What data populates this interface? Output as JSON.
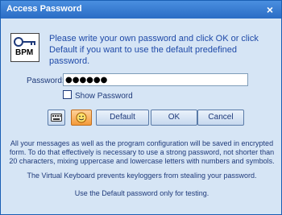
{
  "window": {
    "title": "Access Password",
    "close_glyph": "×"
  },
  "icon": {
    "name": "bpm-key-icon",
    "label": "BPM"
  },
  "intro": "Please write your own password and click OK or click Default if you want to use the default predefined password.",
  "password": {
    "label": "Password:",
    "value": "●●●●●●"
  },
  "show_password": {
    "label": "Show Password",
    "checked": false
  },
  "buttons": {
    "keyboard_icon": "keyboard-icon",
    "smile_icon": "smiley-icon",
    "default_label": "Default",
    "ok_label": "OK",
    "cancel_label": "Cancel"
  },
  "info": [
    "All your messages as well as the program configuration will be saved in encrypted form. To do that effectively is necessary to use a strong password, not shorter than 20 characters, mixing uppercase and lowercase letters with numbers and symbols.",
    "The Virtual Keyboard prevents keyloggers from stealing your password.",
    "Use the Default password only for testing."
  ]
}
